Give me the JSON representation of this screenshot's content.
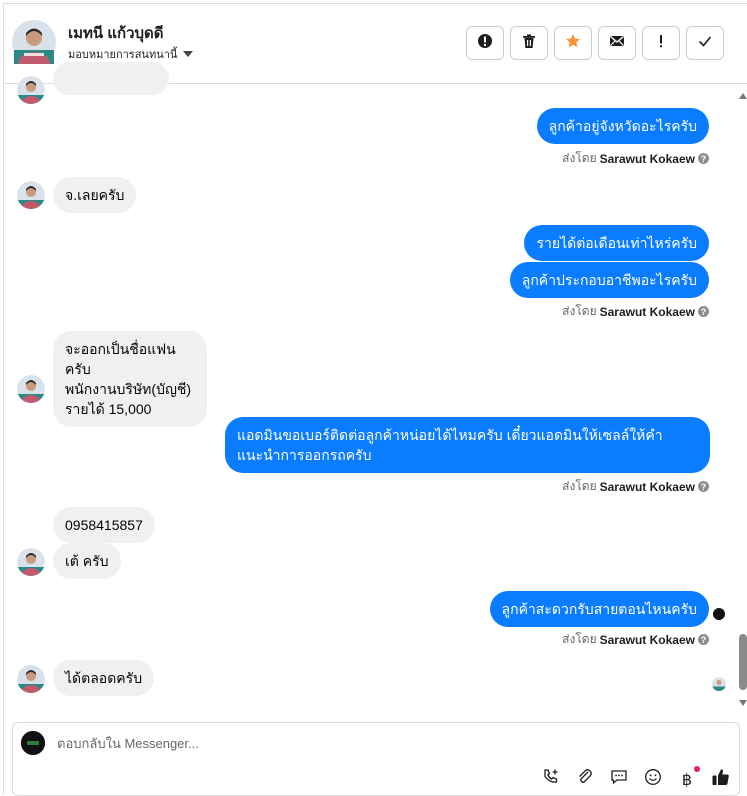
{
  "header": {
    "name": "เมทนี แก้วบุดดี",
    "assign_label": "มอบหมายการสนทนานี้",
    "actions": [
      "spam-icon",
      "trash-icon",
      "star-icon",
      "mail-icon",
      "important-icon",
      "check-icon"
    ]
  },
  "conversation": {
    "messages": [
      {
        "from": "customer",
        "text": "จ.เลยครับ"
      },
      {
        "from": "page",
        "text": "ลูกค้าอยู่จังหวัดอะไรครับ"
      },
      {
        "from": "page",
        "text": "รายได้ต่อเดือนเท่าไหร่ครับ"
      },
      {
        "from": "page",
        "text": "ลูกค้าประกอบอาชีพอะไรครับ"
      },
      {
        "from": "customer",
        "lines": [
          "จะออกเป็นชื่อแฟนครับ",
          "พนักงานบริษัท(บัญชี)",
          "รายได้ 15,000"
        ]
      },
      {
        "from": "page",
        "text": "แอดมินขอเบอร์ติดต่อลูกค้าหน่อยได้ไหมครับ เดี๋ยวแอดมินให้เซลล์ให้คำแนะนำการออกรถครับ"
      },
      {
        "from": "customer",
        "text": "0958415857"
      },
      {
        "from": "customer",
        "text": "เต้ ครับ"
      },
      {
        "from": "page",
        "text": "ลูกค้าสะดวกรับสายตอนไหนครับ"
      },
      {
        "from": "customer",
        "text": "ได้ตลอดครับ"
      }
    ],
    "sent_by_prefix": "ส่งโดย",
    "sent_by_name": "Sarawut Kokaew"
  },
  "composer": {
    "placeholder": "ตอบกลับใน Messenger..."
  },
  "colors": {
    "outgoing_bubble": "#0a7cff",
    "incoming_bubble": "#f0f0f0",
    "star": "#f7923a"
  }
}
